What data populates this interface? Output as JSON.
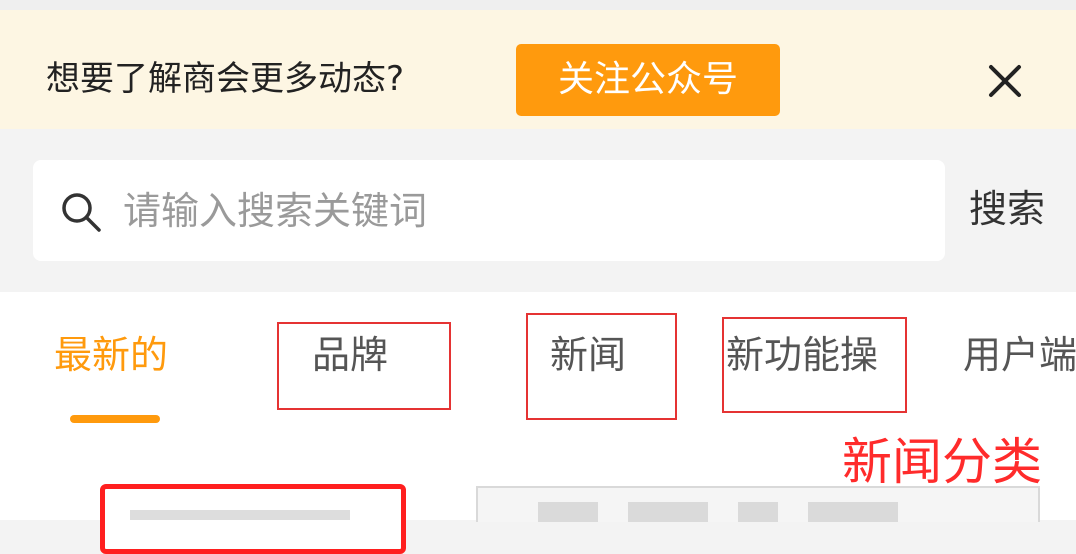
{
  "banner": {
    "text": "想要了解商会更多动态?",
    "follow_button": "关注公众号"
  },
  "search": {
    "placeholder": "请输入搜索关键词",
    "button_label": "搜索"
  },
  "tabs": [
    {
      "label": "最新的",
      "active": true
    },
    {
      "label": "品牌",
      "active": false
    },
    {
      "label": "新闻",
      "active": false
    },
    {
      "label": "新功能操",
      "active": false
    },
    {
      "label": "用户端",
      "active": false
    }
  ],
  "annotation": {
    "label": "新闻分类",
    "color": "#ff2b2b"
  },
  "colors": {
    "accent": "#ff9a0d",
    "banner_bg": "#fdf6e3",
    "annotation_red": "#e53333"
  }
}
